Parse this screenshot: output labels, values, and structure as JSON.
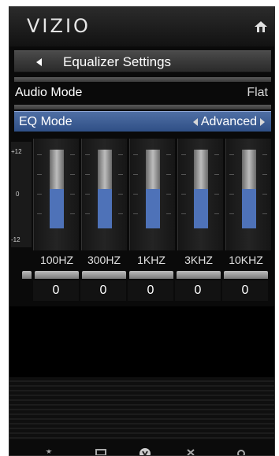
{
  "header": {
    "logo": "VIZIO"
  },
  "menu": {
    "title": "Equalizer Settings",
    "audio_mode": {
      "label": "Audio Mode",
      "value": "Flat"
    },
    "eq_mode": {
      "label": "EQ Mode",
      "value": "Advanced"
    }
  },
  "equalizer": {
    "scale": [
      "+12",
      "0",
      "-12"
    ],
    "bands": [
      {
        "freq": "100HZ",
        "value": "0",
        "level": 0.5
      },
      {
        "freq": "300HZ",
        "value": "0",
        "level": 0.5
      },
      {
        "freq": "1KHZ",
        "value": "0",
        "level": 0.5
      },
      {
        "freq": "3KHZ",
        "value": "0",
        "level": 0.5
      },
      {
        "freq": "10KHZ",
        "value": "0",
        "level": 0.5
      }
    ]
  },
  "colors": {
    "accent": "#4e72b8",
    "selected_row": "#3c5c94"
  },
  "icons": [
    "home-icon",
    "back-arrow-icon",
    "left-arrow-icon",
    "right-arrow-icon",
    "star-icon",
    "screen-icon",
    "vizio-v-icon",
    "close-icon",
    "gear-icon"
  ]
}
